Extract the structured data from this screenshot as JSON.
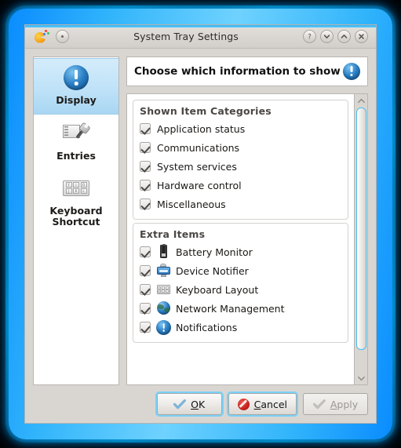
{
  "window": {
    "title": "System Tray Settings",
    "app_icon": "pacman-icon",
    "titlebar_buttons": [
      {
        "name": "shade-button",
        "glyph": "·"
      },
      {
        "name": "help-button",
        "glyph": "?"
      },
      {
        "name": "minimize-button",
        "glyph": "⌄"
      },
      {
        "name": "maximize-button",
        "glyph": "⌃"
      },
      {
        "name": "close-button",
        "glyph": "✕"
      }
    ]
  },
  "sidebar": {
    "items": [
      {
        "label": "Display",
        "icon": "info-circle-icon",
        "selected": true
      },
      {
        "label": "Entries",
        "icon": "wrench-window-icon",
        "selected": false
      },
      {
        "label": "Keyboard\nShortcut",
        "label_line1": "Keyboard",
        "label_line2": "Shortcut",
        "icon": "keyboard-icon",
        "selected": false
      }
    ]
  },
  "header": {
    "title": "Choose which information to show",
    "icon": "info-circle-icon"
  },
  "groups": [
    {
      "title": "Shown Item Categories",
      "items": [
        {
          "label": "Application status",
          "checked": true
        },
        {
          "label": "Communications",
          "checked": true
        },
        {
          "label": "System services",
          "checked": true
        },
        {
          "label": "Hardware control",
          "checked": true
        },
        {
          "label": "Miscellaneous",
          "checked": true
        }
      ]
    },
    {
      "title": "Extra Items",
      "items": [
        {
          "label": "Battery Monitor",
          "checked": true,
          "icon": "battery-icon"
        },
        {
          "label": "Device Notifier",
          "checked": true,
          "icon": "device-monitor-icon"
        },
        {
          "label": "Keyboard Layout",
          "checked": true,
          "icon": "keyboard-layout-icon"
        },
        {
          "label": "Network Management",
          "checked": true,
          "icon": "globe-icon"
        },
        {
          "label": "Notifications",
          "checked": true,
          "icon": "info-circle-icon"
        }
      ]
    }
  ],
  "scrollbar": {
    "up_arrow": "chevron-up-icon",
    "down_arrow": "chevron-down-icon"
  },
  "footer": {
    "ok": {
      "label": "OK",
      "accel": "O",
      "rest": "K",
      "icon": "check-icon",
      "enabled": true
    },
    "cancel": {
      "label": "Cancel",
      "accel": "C",
      "rest": "ancel",
      "icon": "cancel-icon",
      "enabled": true
    },
    "apply": {
      "label": "Apply",
      "accel": "A",
      "rest": "pply",
      "icon": "check-icon",
      "enabled": false
    }
  },
  "colors": {
    "frame_blue": "#31b4fb",
    "window_bg": "#d9d6d2",
    "selection_blue": "#bfe2f8",
    "accent_cyan": "#46c0f5",
    "cancel_red": "#c01b16"
  }
}
